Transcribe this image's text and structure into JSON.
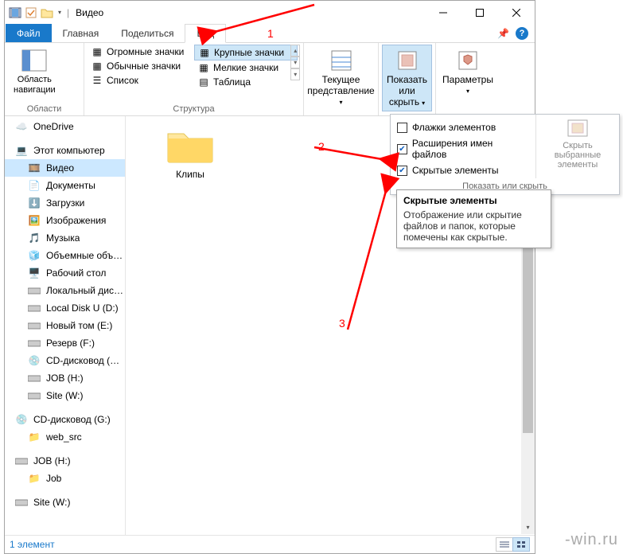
{
  "window": {
    "title": "Видео"
  },
  "tabs": {
    "file": "Файл",
    "home": "Главная",
    "share": "Поделиться",
    "view": "Вид"
  },
  "ribbon": {
    "nav_pane": "Область\nнавигации",
    "nav_group": "Области",
    "layouts": {
      "xl": "Огромные значки",
      "lg": "Крупные значки",
      "md": "Обычные значки",
      "sm": "Мелкие значки",
      "list": "Список",
      "table": "Таблица"
    },
    "layouts_group": "Структура",
    "current_view": "Текущее\nпредставление",
    "show_hide": "Показать\nили скрыть",
    "options": "Параметры"
  },
  "tree": {
    "onedrive": "OneDrive",
    "this_pc": "Этот компьютер",
    "video": "Видео",
    "documents": "Документы",
    "downloads": "Загрузки",
    "pictures": "Изображения",
    "music": "Музыка",
    "objects3d": "Объемные объ…",
    "desktop": "Рабочий стол",
    "localdisk": "Локальный дис…",
    "localu": "Local Disk U (D:)",
    "newvol": "Новый том (E:)",
    "reserve": "Резерв (F:)",
    "cdg": "CD-дисковод (G…",
    "jobh": "JOB (H:)",
    "sitew": "Site (W:)",
    "cdg2": "CD-дисковод (G:)",
    "websrc": "web_src",
    "jobh2": "JOB (H:)",
    "job": "Job",
    "sitew2": "Site (W:)"
  },
  "folders": {
    "item0": "Клипы"
  },
  "dropdown": {
    "item_checkboxes": "Флажки элементов",
    "file_ext": "Расширения имен файлов",
    "hidden": "Скрытые элементы",
    "hide_selected": "Скрыть выбранные\nэлементы",
    "footer": "Показать или скрыть"
  },
  "tooltip": {
    "title": "Скрытые элементы",
    "body": "Отображение или скрытие файлов и папок, которые помечены как скрытые."
  },
  "status": {
    "count": "1 элемент"
  },
  "ann": {
    "n1": "1",
    "n2": "2",
    "n3": "3"
  },
  "watermark": "-win.ru"
}
